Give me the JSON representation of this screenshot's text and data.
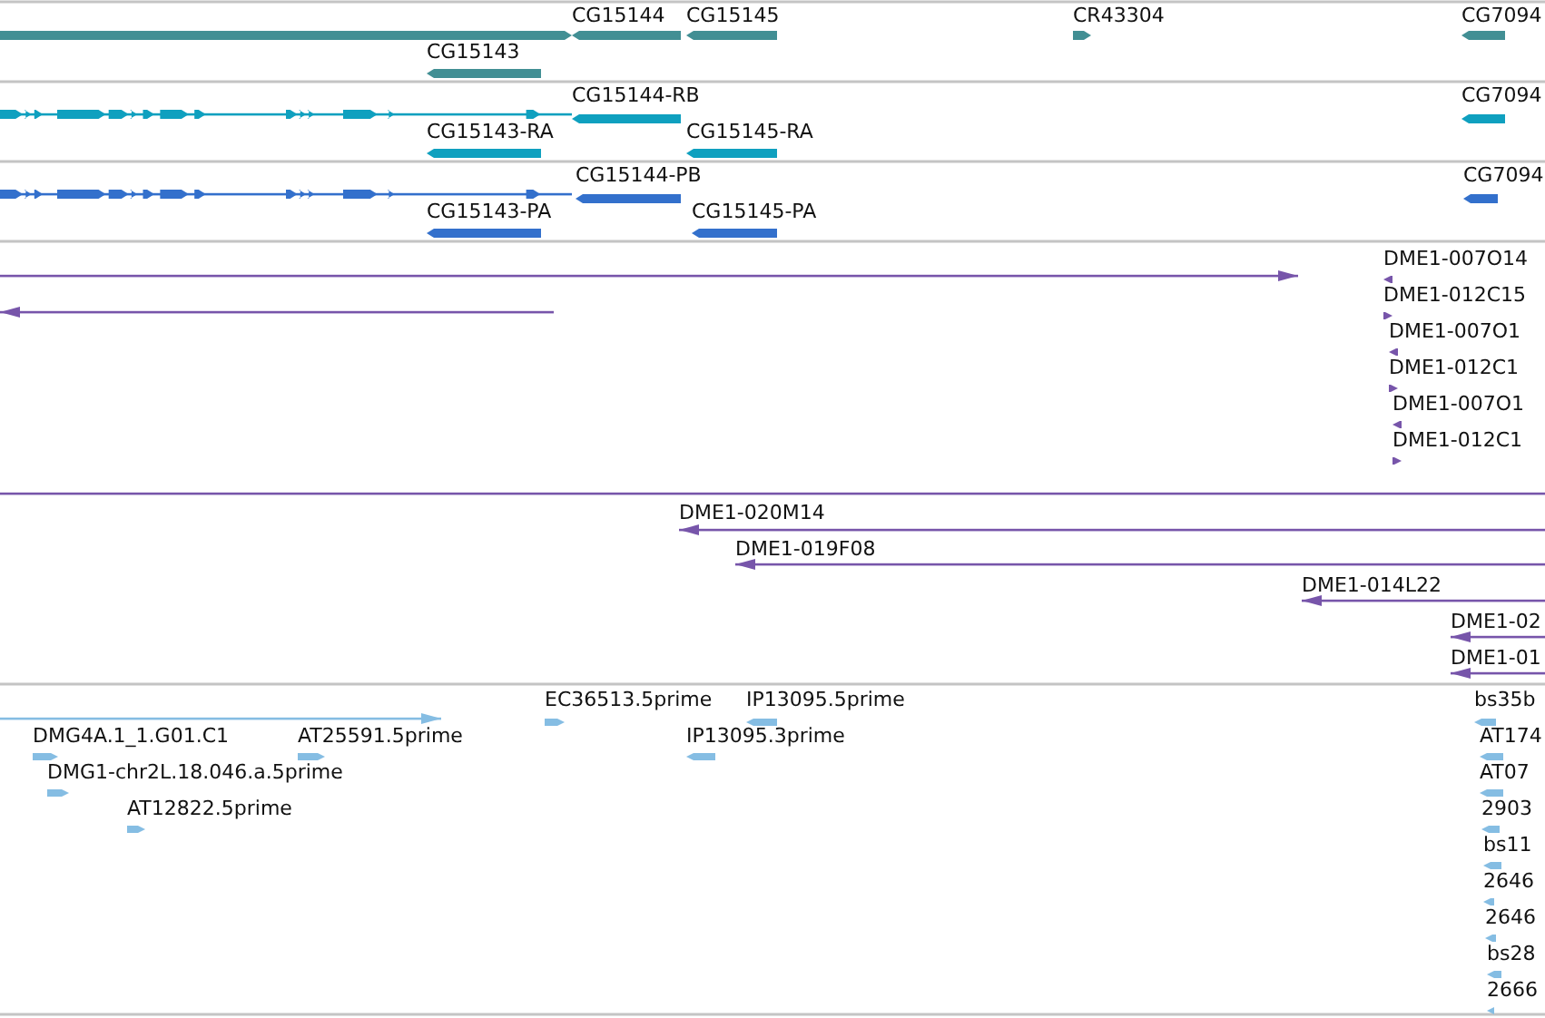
{
  "tracks": [
    {
      "color": "#428f94",
      "features": [
        {
          "kind": "bar",
          "reverse": false
        },
        {
          "kind": "bar",
          "label": "CG15144",
          "reverse": true
        },
        {
          "kind": "bar",
          "label": "CG15145",
          "reverse": true
        },
        {
          "kind": "bar",
          "label": "CR43304",
          "reverse": false
        },
        {
          "kind": "bar",
          "label": "CG7094",
          "reverse": true
        },
        {
          "kind": "bar",
          "label": "CG15143",
          "reverse": true
        }
      ]
    },
    {
      "color": "#0fa0bf",
      "features": [
        {
          "kind": "model",
          "reverse": false
        },
        {
          "kind": "bar",
          "label": "CG15144-RB",
          "reverse": true
        },
        {
          "kind": "bar",
          "label": "CG15143-RA",
          "reverse": true
        },
        {
          "kind": "bar",
          "label": "CG15145-RA",
          "reverse": true
        },
        {
          "kind": "bar",
          "label": "CG7094",
          "reverse": true
        }
      ]
    },
    {
      "color": "#3370cc",
      "features": [
        {
          "kind": "model",
          "reverse": false
        },
        {
          "kind": "bar",
          "label": "CG15144-PB",
          "reverse": true
        },
        {
          "kind": "bar",
          "label": "CG15143-PA",
          "reverse": true
        },
        {
          "kind": "bar",
          "label": "CG15145-PA",
          "reverse": true
        },
        {
          "kind": "bar",
          "label": "CG7094",
          "reverse": true
        }
      ]
    },
    {
      "color": "#7755aa",
      "features": [
        {
          "kind": "line",
          "reverse": false
        },
        {
          "kind": "line",
          "reverse": true
        },
        {
          "kind": "bar",
          "label": "DME1-007O14",
          "reverse": true
        },
        {
          "kind": "bar",
          "label": "DME1-012C15",
          "reverse": false
        },
        {
          "kind": "bar",
          "label": "DME1-007O1",
          "reverse": true
        },
        {
          "kind": "bar",
          "label": "DME1-012C1",
          "reverse": false
        },
        {
          "kind": "bar",
          "label": "DME1-007O1",
          "reverse": true
        },
        {
          "kind": "bar",
          "label": "DME1-012C1",
          "reverse": false
        }
      ]
    },
    {
      "color": "#7755aa",
      "features": [
        {
          "kind": "line"
        },
        {
          "kind": "line",
          "label": "DME1-020M14",
          "reverse": true
        },
        {
          "kind": "line",
          "label": "DME1-019F08",
          "reverse": true
        },
        {
          "kind": "line",
          "label": "DME1-014L22",
          "reverse": true
        },
        {
          "kind": "line",
          "label": "DME1-02",
          "reverse": true
        },
        {
          "kind": "line",
          "label": "DME1-01",
          "reverse": true
        }
      ]
    },
    {
      "color": "#85bde3",
      "features": [
        {
          "kind": "line",
          "reverse": false
        },
        {
          "kind": "bar",
          "label": "EC36513.5prime",
          "reverse": false
        },
        {
          "kind": "bar",
          "label": "IP13095.5prime",
          "reverse": true
        },
        {
          "kind": "bar",
          "label": "DMG4A.1_1.G01.C1",
          "reverse": false
        },
        {
          "kind": "bar",
          "label": "AT25591.5prime",
          "reverse": false
        },
        {
          "kind": "bar",
          "label": "IP13095.3prime",
          "reverse": true
        },
        {
          "kind": "bar",
          "label": "DMG1-chr2L.18.046.a.5prime",
          "reverse": false
        },
        {
          "kind": "bar",
          "label": "AT12822.5prime",
          "reverse": false
        },
        {
          "kind": "bar",
          "label": "bs35b",
          "reverse": true
        },
        {
          "kind": "bar",
          "label": "AT174",
          "reverse": true
        },
        {
          "kind": "bar",
          "label": "AT07",
          "reverse": true
        },
        {
          "kind": "bar",
          "label": "2903",
          "reverse": true
        },
        {
          "kind": "bar",
          "label": "bs11",
          "reverse": true
        },
        {
          "kind": "bar",
          "label": "2646",
          "reverse": true
        },
        {
          "kind": "bar",
          "label": "2646",
          "reverse": true
        },
        {
          "kind": "bar",
          "label": "bs28",
          "reverse": true
        },
        {
          "kind": "bar",
          "label": "2666",
          "reverse": true
        }
      ]
    }
  ]
}
